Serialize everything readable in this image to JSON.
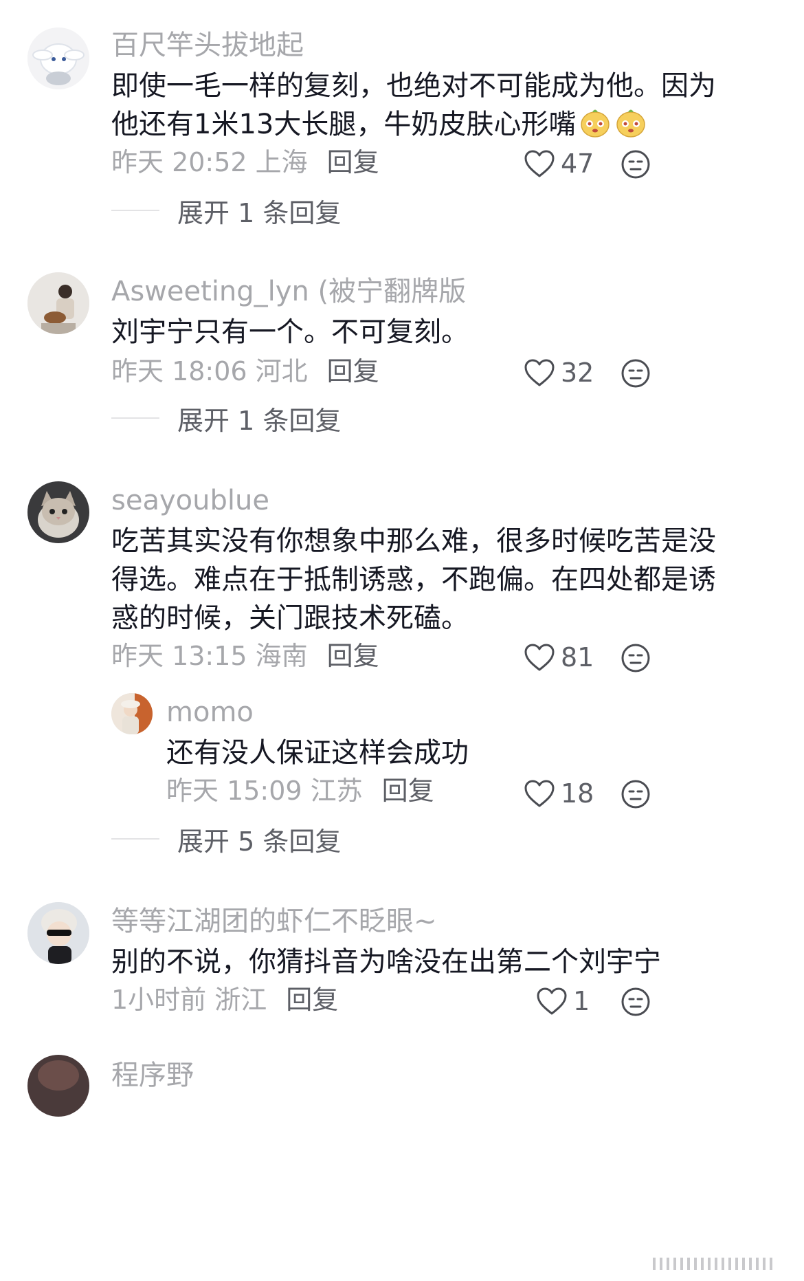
{
  "comments": [
    {
      "username": "百尺竿头拔地起",
      "lines": [
        "即使一毛一样的复刻，也绝对不可能成为他。因为",
        "他还有1米13大长腿，牛奶皮肤心形嘴"
      ],
      "time": "昨天 20:52 上海",
      "reply_label": "回复",
      "likes": "47",
      "expand_label": "展开 1 条回复",
      "avatar_icon": "cinnamoroll-avatar-icon"
    },
    {
      "username": "Asweeting_lyn (被宁翻牌版",
      "lines": [
        "刘宇宁只有一个。不可复刻。"
      ],
      "time": "昨天 18:06 河北",
      "reply_label": "回复",
      "likes": "32",
      "expand_label": "展开 1 条回复",
      "avatar_icon": "person-with-guitar-avatar-icon"
    },
    {
      "username": "seayoublue",
      "lines": [
        "吃苦其实没有你想象中那么难，很多时候吃苦是没",
        "得选。难点在于抵制诱惑，不跑偏。在四处都是诱",
        "惑的时候，关门跟技术死磕。"
      ],
      "time": "昨天 13:15 海南",
      "reply_label": "回复",
      "likes": "81",
      "expand_label": "展开 5 条回复",
      "avatar_icon": "cat-avatar-icon",
      "reply": {
        "username": "momo",
        "text": "还有没人保证这样会成功",
        "time": "昨天 15:09 江苏",
        "reply_label": "回复",
        "likes": "18",
        "avatar_icon": "girl-autumn-avatar-icon"
      }
    },
    {
      "username": "等等江湖团的虾仁不眨眼~",
      "lines": [
        "别的不说，你猜抖音为啥没在出第二个刘宇宁"
      ],
      "time": "1小时前 浙江",
      "reply_label": "回复",
      "likes": "1",
      "avatar_icon": "sunglasses-person-avatar-icon"
    },
    {
      "username": "程序野",
      "avatar_icon": "partial-avatar-icon"
    }
  ],
  "colors": {
    "text": "#161823",
    "meta": "#a6a7ab",
    "action": "#5d5f66"
  }
}
